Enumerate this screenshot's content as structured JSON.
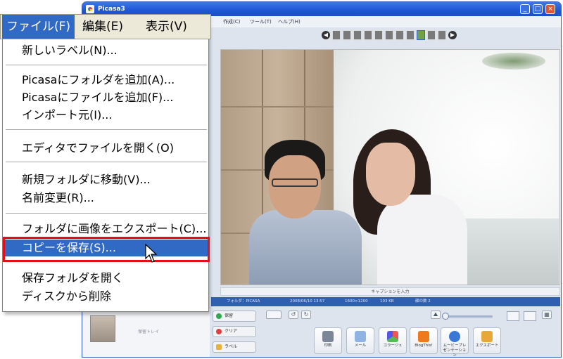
{
  "window": {
    "title": "Picasa3",
    "minimize": "_",
    "maximize": "□",
    "close": "×"
  },
  "app_menubar": {
    "items": [
      "作成(C)",
      "ツール(T)",
      "ヘルプ(H)"
    ]
  },
  "menubar": {
    "file": "ファイル(F)",
    "edit": "編集(E)",
    "view": "表示(V)"
  },
  "file_menu": {
    "new_label": "新しいラベル(N)...",
    "add_folder": "Picasaにフォルダを追加(A)...",
    "add_file": "Picasaにファイルを追加(F)...",
    "import_from": "インポート元(I)...",
    "open_in_editor": "エディタでファイルを開く(O)",
    "move_to_new_folder": "新規フォルダに移動(V)...",
    "rename": "名前変更(R)...",
    "export_images": "フォルダに画像をエクスポート(C)...",
    "save_copy": "コピーを保存(S)...",
    "open_save_folder": "保存フォルダを開く",
    "delete_from_disk": "ディスクから削除"
  },
  "photo_viewer": {
    "caption_placeholder": "キャプションを入力",
    "info": [
      "フォルダ：PICASA",
      "2008/06/10 13:57",
      "1600×1200",
      "103 KB",
      "顔の数 2"
    ]
  },
  "tray": {
    "label": "保留トレイ"
  },
  "side_buttons": [
    "保留",
    "クリア",
    "ラベル"
  ],
  "actions": [
    "印刷",
    "メール",
    "コラージュ",
    "BlogThis!",
    "ムービープレゼンテーション",
    "エクスポート"
  ],
  "colors": {
    "menu_highlight": "#316ac5",
    "red_outline": "#e0101a",
    "menubar_bg": "#ece9d8",
    "titlebar": "#1f56d4"
  }
}
